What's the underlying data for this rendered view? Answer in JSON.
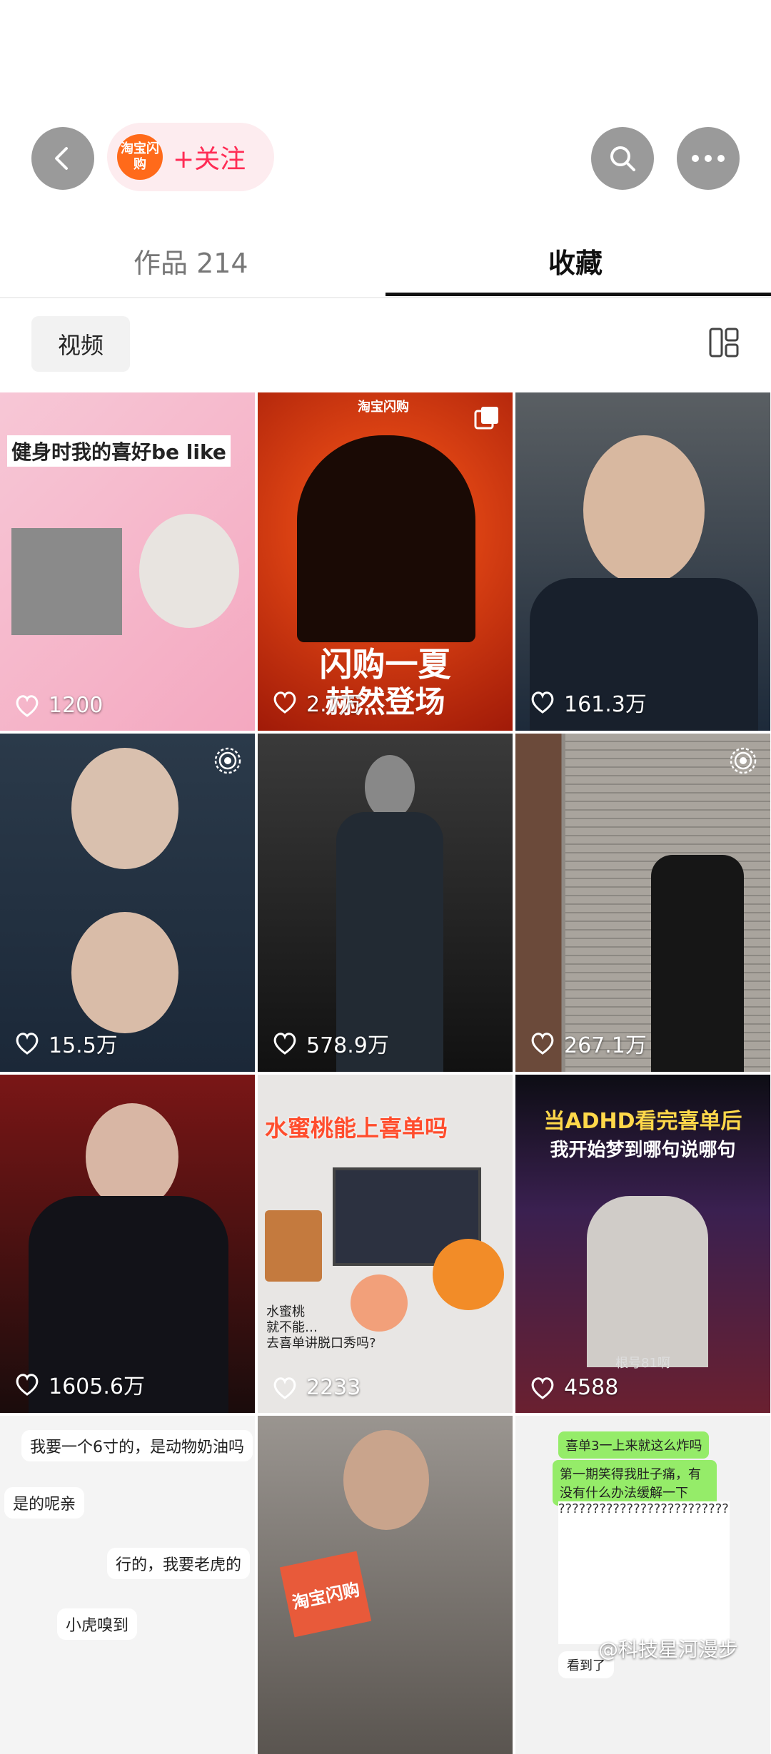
{
  "header": {
    "brand_logo_text": "淘宝闪购",
    "follow_label": "+关注"
  },
  "tabs": {
    "works_label": "作品 214",
    "favorites_label": "收藏"
  },
  "filter": {
    "chip_label": "视频"
  },
  "grid": {
    "items": [
      {
        "likes": "1200",
        "caption": "健身时我的喜好be like"
      },
      {
        "likes": "2.7万",
        "caption": "闪购一夏",
        "caption2": "赫然登场",
        "brand": "淘宝闪购"
      },
      {
        "likes": "161.3万"
      },
      {
        "likes": "15.5万"
      },
      {
        "likes": "578.9万"
      },
      {
        "likes": "267.1万"
      },
      {
        "likes": "1605.6万"
      },
      {
        "likes": "2233",
        "caption": "水蜜桃能上喜单吗",
        "sub1": "水蜜桃",
        "sub2": "就不能…",
        "sub3": "去喜单讲脱口秀吗?"
      },
      {
        "likes": "4588",
        "caption": "当ADHD看完喜单后",
        "caption2": "我开始梦到哪句说哪句",
        "tag": "根号81啊"
      },
      {
        "chat1": "我要一个6寸的，是动物奶油吗",
        "chat2": "是的呢亲",
        "chat3": "行的，我要老虎的",
        "chat4": "小虎嗅到"
      },
      {
        "brand": "淘宝闪购"
      },
      {
        "chat1": "喜单3一上来就这么炸吗",
        "chat2": "第一期笑得我肚子痛，有没有什么办法缓解一下",
        "chat3": "看到了"
      }
    ]
  },
  "watermark": "@科技星河漫步",
  "colors": {
    "accent": "#ff2c55",
    "brand_orange": "#ff6a1a",
    "button_gray": "#9a9a9a"
  }
}
